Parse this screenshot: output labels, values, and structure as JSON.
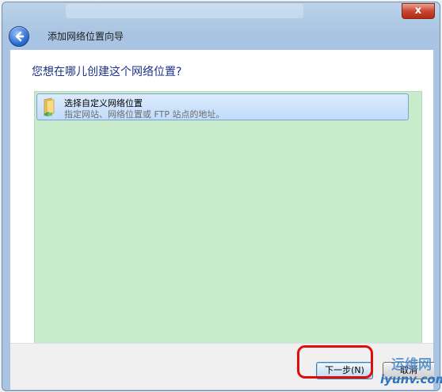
{
  "window": {
    "close_symbol": "x"
  },
  "wizard": {
    "title": "添加网络位置向导",
    "question": "您想在哪儿创建这个网络位置?",
    "items": [
      {
        "title": "选择自定义网络位置",
        "description": "指定网站、网络位置或 FTP 站点的地址。",
        "icon": "folder-network-icon"
      }
    ]
  },
  "buttons": {
    "next": "下一步(N)",
    "cancel": "取消"
  },
  "watermark": {
    "line1": "运维网",
    "line2": "iyunv.com"
  },
  "colors": {
    "list_background": "#c8ebcc",
    "question_text": "#1e3287",
    "annotation": "#e00d0d"
  }
}
